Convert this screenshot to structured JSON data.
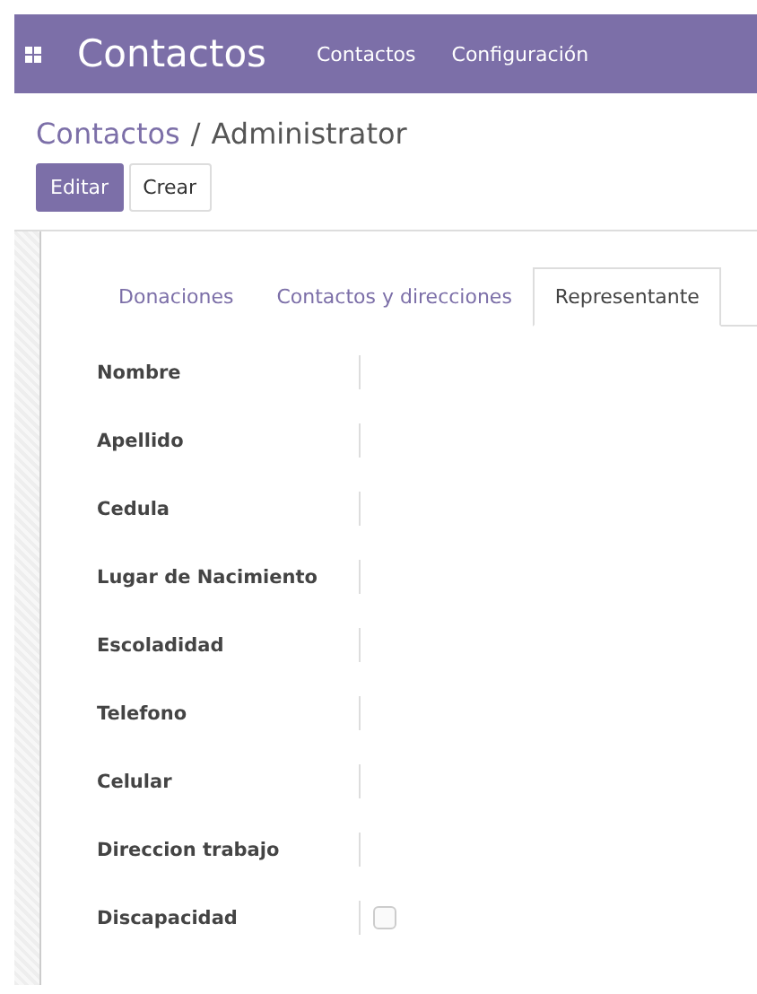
{
  "navbar": {
    "app_title": "Contactos",
    "menu": [
      {
        "label": "Contactos"
      },
      {
        "label": "Configuración"
      }
    ]
  },
  "breadcrumb": {
    "parent": "Contactos",
    "separator": "/",
    "current": "Administrator"
  },
  "buttons": [
    {
      "label": "Editar",
      "kind": "primary"
    },
    {
      "label": "Crear",
      "kind": "secondary"
    }
  ],
  "tabs": [
    {
      "label": "Donaciones",
      "selected": false
    },
    {
      "label": "Contactos y direcciones",
      "selected": false
    },
    {
      "label": "Representante",
      "selected": true
    }
  ],
  "fields": [
    {
      "label": "Nombre",
      "kind": "text"
    },
    {
      "label": "Apellido",
      "kind": "text"
    },
    {
      "label": "Cedula",
      "kind": "text"
    },
    {
      "label": "Lugar de Nacimiento",
      "kind": "text"
    },
    {
      "label": "Escoladidad",
      "kind": "text"
    },
    {
      "label": "Telefono",
      "kind": "text"
    },
    {
      "label": "Celular",
      "kind": "text"
    },
    {
      "label": "Direccion trabajo",
      "kind": "text"
    },
    {
      "label": "Discapacidad",
      "kind": "checkbox",
      "checked": false
    }
  ]
}
